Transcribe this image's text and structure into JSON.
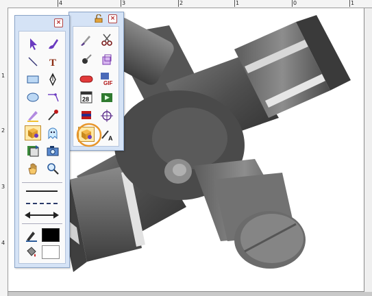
{
  "ruler": {
    "top_labels": [
      "4",
      "3",
      "2",
      "1",
      "0",
      "1"
    ],
    "left_labels": [
      "1",
      "2",
      "3",
      "4"
    ]
  },
  "colors": {
    "palette_bg": "#d5e3f6",
    "palette_border": "#8aa4c8",
    "close_button": "#b02020",
    "selected_tool": "#ffe9a8",
    "highlight_ring": "#e8962b",
    "fill_swatch": "#000000",
    "line_swatch": "#ffffff"
  },
  "main_palette": {
    "close_label": "×",
    "tools": [
      {
        "name": "select-arrow",
        "icon": "arrow-icon"
      },
      {
        "name": "freehand",
        "icon": "brush-icon"
      },
      {
        "name": "line",
        "icon": "line-icon"
      },
      {
        "name": "text",
        "icon": "text-icon",
        "glyph": "T"
      },
      {
        "name": "rectangle",
        "icon": "rectangle-icon"
      },
      {
        "name": "pen",
        "icon": "pen-icon"
      },
      {
        "name": "ellipse",
        "icon": "ellipse-icon"
      },
      {
        "name": "dimension",
        "icon": "dimension-icon"
      },
      {
        "name": "highlighter",
        "icon": "highlighter-icon"
      },
      {
        "name": "eyedropper",
        "icon": "eyedropper-icon"
      },
      {
        "name": "3d-object",
        "icon": "box-icon"
      },
      {
        "name": "ghost",
        "icon": "ghost-icon"
      },
      {
        "name": "rotate-view",
        "icon": "rotate-icon"
      },
      {
        "name": "camera",
        "icon": "camera-icon"
      },
      {
        "name": "pan",
        "icon": "hand-icon"
      },
      {
        "name": "zoom",
        "icon": "magnifier-icon"
      }
    ],
    "line_styles": [
      "solid-line",
      "dashed-line",
      "arrow-line"
    ]
  },
  "secondary_palette": {
    "close_label": "×",
    "tools": [
      {
        "name": "knife",
        "icon": "knife-icon"
      },
      {
        "name": "scissors",
        "icon": "scissors-icon"
      },
      {
        "name": "pin",
        "icon": "pin-icon"
      },
      {
        "name": "crop",
        "icon": "crop-icon"
      },
      {
        "name": "capsule",
        "icon": "capsule-icon"
      },
      {
        "name": "gif-export",
        "icon": "gif-icon",
        "label": "GIF"
      },
      {
        "name": "calendar",
        "icon": "calendar-icon",
        "label": "28"
      },
      {
        "name": "play",
        "icon": "play-icon"
      },
      {
        "name": "flag",
        "icon": "flag-icon"
      },
      {
        "name": "crosshair",
        "icon": "crosshair-icon"
      },
      {
        "name": "3d-box-selected",
        "icon": "box-icon"
      },
      {
        "name": "dropper-text",
        "icon": "dropper-a-icon",
        "label": "A"
      }
    ]
  }
}
